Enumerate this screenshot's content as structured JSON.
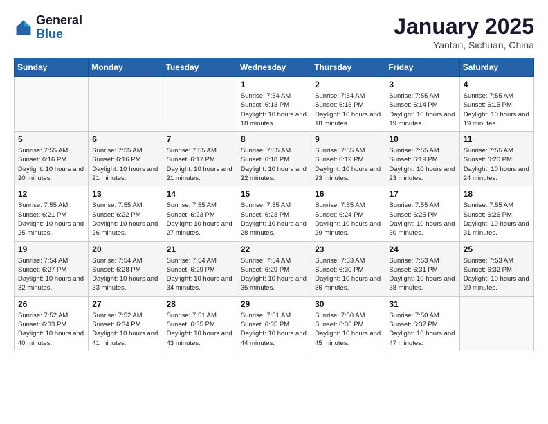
{
  "header": {
    "logo_line1": "General",
    "logo_line2": "Blue",
    "month": "January 2025",
    "location": "Yantan, Sichuan, China"
  },
  "weekdays": [
    "Sunday",
    "Monday",
    "Tuesday",
    "Wednesday",
    "Thursday",
    "Friday",
    "Saturday"
  ],
  "weeks": [
    [
      {
        "day": "",
        "info": ""
      },
      {
        "day": "",
        "info": ""
      },
      {
        "day": "",
        "info": ""
      },
      {
        "day": "1",
        "info": "Sunrise: 7:54 AM\nSunset: 6:13 PM\nDaylight: 10 hours and 18 minutes."
      },
      {
        "day": "2",
        "info": "Sunrise: 7:54 AM\nSunset: 6:13 PM\nDaylight: 10 hours and 18 minutes."
      },
      {
        "day": "3",
        "info": "Sunrise: 7:55 AM\nSunset: 6:14 PM\nDaylight: 10 hours and 19 minutes."
      },
      {
        "day": "4",
        "info": "Sunrise: 7:55 AM\nSunset: 6:15 PM\nDaylight: 10 hours and 19 minutes."
      }
    ],
    [
      {
        "day": "5",
        "info": "Sunrise: 7:55 AM\nSunset: 6:16 PM\nDaylight: 10 hours and 20 minutes."
      },
      {
        "day": "6",
        "info": "Sunrise: 7:55 AM\nSunset: 6:16 PM\nDaylight: 10 hours and 21 minutes."
      },
      {
        "day": "7",
        "info": "Sunrise: 7:55 AM\nSunset: 6:17 PM\nDaylight: 10 hours and 21 minutes."
      },
      {
        "day": "8",
        "info": "Sunrise: 7:55 AM\nSunset: 6:18 PM\nDaylight: 10 hours and 22 minutes."
      },
      {
        "day": "9",
        "info": "Sunrise: 7:55 AM\nSunset: 6:19 PM\nDaylight: 10 hours and 23 minutes."
      },
      {
        "day": "10",
        "info": "Sunrise: 7:55 AM\nSunset: 6:19 PM\nDaylight: 10 hours and 23 minutes."
      },
      {
        "day": "11",
        "info": "Sunrise: 7:55 AM\nSunset: 6:20 PM\nDaylight: 10 hours and 24 minutes."
      }
    ],
    [
      {
        "day": "12",
        "info": "Sunrise: 7:55 AM\nSunset: 6:21 PM\nDaylight: 10 hours and 25 minutes."
      },
      {
        "day": "13",
        "info": "Sunrise: 7:55 AM\nSunset: 6:22 PM\nDaylight: 10 hours and 26 minutes."
      },
      {
        "day": "14",
        "info": "Sunrise: 7:55 AM\nSunset: 6:23 PM\nDaylight: 10 hours and 27 minutes."
      },
      {
        "day": "15",
        "info": "Sunrise: 7:55 AM\nSunset: 6:23 PM\nDaylight: 10 hours and 28 minutes."
      },
      {
        "day": "16",
        "info": "Sunrise: 7:55 AM\nSunset: 6:24 PM\nDaylight: 10 hours and 29 minutes."
      },
      {
        "day": "17",
        "info": "Sunrise: 7:55 AM\nSunset: 6:25 PM\nDaylight: 10 hours and 30 minutes."
      },
      {
        "day": "18",
        "info": "Sunrise: 7:55 AM\nSunset: 6:26 PM\nDaylight: 10 hours and 31 minutes."
      }
    ],
    [
      {
        "day": "19",
        "info": "Sunrise: 7:54 AM\nSunset: 6:27 PM\nDaylight: 10 hours and 32 minutes."
      },
      {
        "day": "20",
        "info": "Sunrise: 7:54 AM\nSunset: 6:28 PM\nDaylight: 10 hours and 33 minutes."
      },
      {
        "day": "21",
        "info": "Sunrise: 7:54 AM\nSunset: 6:29 PM\nDaylight: 10 hours and 34 minutes."
      },
      {
        "day": "22",
        "info": "Sunrise: 7:54 AM\nSunset: 6:29 PM\nDaylight: 10 hours and 35 minutes."
      },
      {
        "day": "23",
        "info": "Sunrise: 7:53 AM\nSunset: 6:30 PM\nDaylight: 10 hours and 36 minutes."
      },
      {
        "day": "24",
        "info": "Sunrise: 7:53 AM\nSunset: 6:31 PM\nDaylight: 10 hours and 38 minutes."
      },
      {
        "day": "25",
        "info": "Sunrise: 7:53 AM\nSunset: 6:32 PM\nDaylight: 10 hours and 39 minutes."
      }
    ],
    [
      {
        "day": "26",
        "info": "Sunrise: 7:52 AM\nSunset: 6:33 PM\nDaylight: 10 hours and 40 minutes."
      },
      {
        "day": "27",
        "info": "Sunrise: 7:52 AM\nSunset: 6:34 PM\nDaylight: 10 hours and 41 minutes."
      },
      {
        "day": "28",
        "info": "Sunrise: 7:51 AM\nSunset: 6:35 PM\nDaylight: 10 hours and 43 minutes."
      },
      {
        "day": "29",
        "info": "Sunrise: 7:51 AM\nSunset: 6:35 PM\nDaylight: 10 hours and 44 minutes."
      },
      {
        "day": "30",
        "info": "Sunrise: 7:50 AM\nSunset: 6:36 PM\nDaylight: 10 hours and 45 minutes."
      },
      {
        "day": "31",
        "info": "Sunrise: 7:50 AM\nSunset: 6:37 PM\nDaylight: 10 hours and 47 minutes."
      },
      {
        "day": "",
        "info": ""
      }
    ]
  ]
}
